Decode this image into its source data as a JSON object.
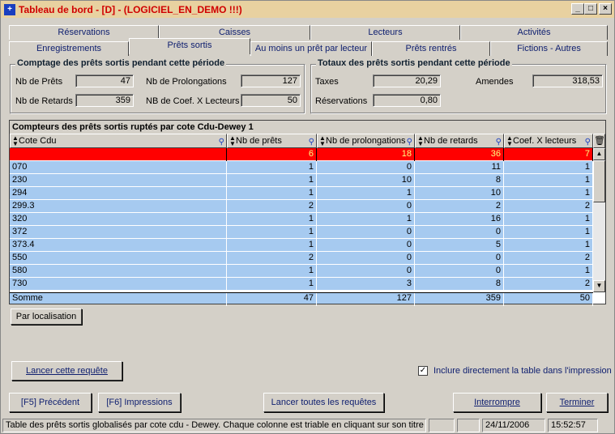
{
  "window": {
    "title": "Tableau de bord  - [D] - (LOGICIEL_EN_DEMO !!!)",
    "icon": "app-icon"
  },
  "tabs_row1": [
    "Réservations",
    "Caisses",
    "Lecteurs",
    "Activités"
  ],
  "tabs_row2": [
    "Enregistrements",
    "Prêts sortis",
    "Au moins un prêt par lecteur",
    "Prêts rentrés",
    "Fictions - Autres"
  ],
  "comptage": {
    "title": "Comptage des prêts sortis pendant cette période",
    "nb_prets_label": "Nb de Prêts",
    "nb_prets": "47",
    "nb_prolong_label": "Nb de Prolongations",
    "nb_prolong": "127",
    "nb_retards_label": "Nb de Retards",
    "nb_retards": "359",
    "nb_coef_label": "NB de Coef. X Lecteurs",
    "nb_coef": "50"
  },
  "totaux": {
    "title": "Totaux des prêts sortis pendant cette période",
    "taxes_label": "Taxes",
    "taxes": "20,29",
    "amendes_label": "Amendes",
    "amendes": "318,53",
    "reservations_label": "Réservations",
    "reservations": "0,80"
  },
  "grid": {
    "title": "Compteurs des prêts sortis ruptés par cote Cdu-Dewey 1",
    "columns": [
      "Cote Cdu",
      "Nb de prêts",
      "Nb de prolongations",
      "Nb de retards",
      "Coef. X lecteurs"
    ],
    "rows": [
      [
        "",
        "6",
        "18",
        "36",
        "7"
      ],
      [
        "070",
        "1",
        "0",
        "11",
        "1"
      ],
      [
        "230",
        "1",
        "10",
        "8",
        "1"
      ],
      [
        "294",
        "1",
        "1",
        "10",
        "1"
      ],
      [
        "299.3",
        "2",
        "0",
        "2",
        "2"
      ],
      [
        "320",
        "1",
        "1",
        "16",
        "1"
      ],
      [
        "372",
        "1",
        "0",
        "0",
        "1"
      ],
      [
        "373.4",
        "1",
        "0",
        "5",
        "1"
      ],
      [
        "550",
        "2",
        "0",
        "0",
        "2"
      ],
      [
        "580",
        "1",
        "0",
        "0",
        "1"
      ],
      [
        "730",
        "1",
        "3",
        "8",
        "2"
      ]
    ],
    "sum": [
      "Somme",
      "47",
      "127",
      "359",
      "50"
    ]
  },
  "buttons": {
    "par_localisation": "Par localisation",
    "lancer_requete": "Lancer cette requête",
    "inclure_label": "Inclure directement la table dans l'impression",
    "precedent": "[F5] Précédent",
    "impressions": "[F6] Impressions",
    "lancer_toutes": "Lancer toutes les requêtes",
    "interrompre": "Interrompre",
    "terminer": "Terminer"
  },
  "status": {
    "message": "Table des prêts sortis globalisés par cote cdu - Dewey. Chaque colonne est triable en cliquant sur son titre",
    "date": "24/11/2006",
    "time": "15:52:57"
  },
  "colors": {
    "selected_row": "#ff0000",
    "row_bg": "#a6caf0",
    "title_text": "#d00000"
  }
}
